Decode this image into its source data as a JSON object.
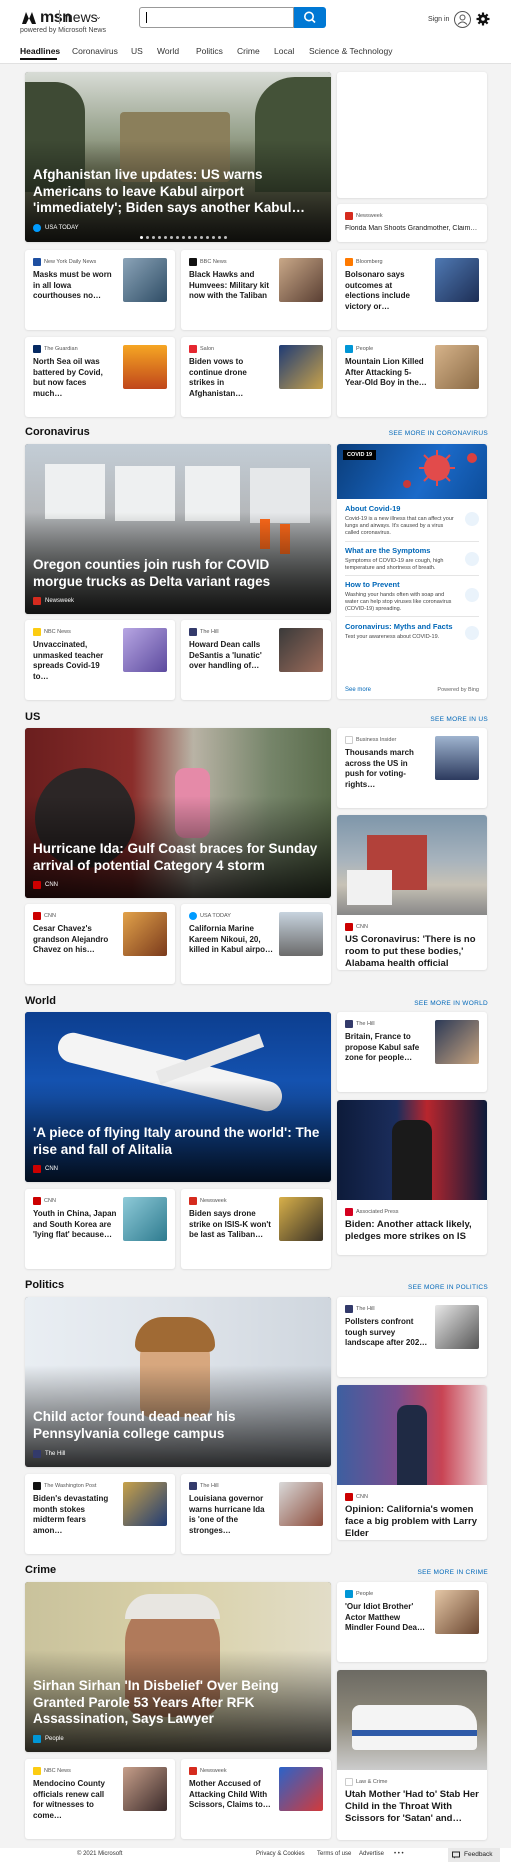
{
  "header": {
    "brand": "msn",
    "product": "news",
    "powered_by": "powered by Microsoft News",
    "search_value": "",
    "sign_in": "Sign in"
  },
  "tabs": [
    "Headlines",
    "Coronavirus",
    "US",
    "World",
    "Politics",
    "Crime",
    "Local",
    "Science & Technology"
  ],
  "headlines": {
    "hero": {
      "title": "Afghanistan live updates: US warns Americans to leave Kabul airport 'immediately'; Biden says another Kabul…",
      "source": "USA TODAY"
    },
    "side": {
      "source": "Newsweek",
      "title": "Florida Man Shoots Grandmother, Claim…"
    },
    "row1": [
      {
        "source": "New York Daily News",
        "title": "Masks must be worn in all Iowa courthouses no…"
      },
      {
        "source": "BBC News",
        "title": "Black Hawks and Humvees: Military kit now with the Taliban"
      },
      {
        "source": "Bloomberg",
        "title": "Bolsonaro says outcomes at elections include victory or…"
      }
    ],
    "row2": [
      {
        "source": "The Guardian",
        "title": "North Sea oil was battered by Covid, but now faces much…"
      },
      {
        "source": "Salon",
        "title": "Biden vows to continue drone strikes in Afghanistan…"
      },
      {
        "source": "People",
        "title": "Mountain Lion Killed After Attacking 5-Year-Old Boy in the…"
      }
    ]
  },
  "coronavirus": {
    "section": "Coronavirus",
    "see_more": "SEE MORE IN CORONAVIRUS",
    "hero": {
      "title": "Oregon counties join rush for COVID morgue trucks as Delta variant rages",
      "source": "Newsweek"
    },
    "widget": {
      "badge": "COVID 19",
      "items": [
        {
          "title": "About Covid-19",
          "desc": "Covid-19 is a new illness that can affect your lungs and airways. It's caused by a virus called coronavirus."
        },
        {
          "title": "What are the Symptoms",
          "desc": "Symptoms of COVID-19 are cough, high temperature and shortness of breath."
        },
        {
          "title": "How to Prevent",
          "desc": "Washing your hands often with soap and water can help stop viruses like coronavirus (COVID-19) spreading."
        },
        {
          "title": "Coronavirus: Myths and Facts",
          "desc": "Test your awareness about COVID-19."
        }
      ],
      "see_more": "See more",
      "powered": "Powered by Bing"
    },
    "row": [
      {
        "source": "NBC News",
        "title": "Unvaccinated, unmasked teacher spreads Covid-19 to…"
      },
      {
        "source": "The Hill",
        "title": "Howard Dean calls DeSantis a 'lunatic' over handling of…"
      }
    ]
  },
  "us": {
    "section": "US",
    "see_more": "SEE MORE IN US",
    "hero": {
      "title": "Hurricane Ida: Gulf Coast braces for Sunday arrival of potential Category 4 storm",
      "source": "CNN"
    },
    "side_small": {
      "source": "Business Insider",
      "title": "Thousands march across the US in push for voting-rights…"
    },
    "side": {
      "source": "CNN",
      "title": "US Coronavirus: 'There is no room to put these bodies,' Alabama health official says…"
    },
    "row": [
      {
        "source": "CNN",
        "title": "Cesar Chavez's grandson Alejandro Chavez on his…"
      },
      {
        "source": "USA TODAY",
        "title": "California Marine Kareem Nikoui, 20, killed in Kabul airpo…"
      }
    ]
  },
  "world": {
    "section": "World",
    "see_more": "SEE MORE IN WORLD",
    "hero": {
      "title": "'A piece of flying Italy around the world': The rise and fall of Alitalia",
      "source": "CNN"
    },
    "side_small": {
      "source": "The Hill",
      "title": "Britain, France to propose Kabul safe zone for people…"
    },
    "side": {
      "source": "Associated Press",
      "title": "Biden: Another attack likely, pledges more strikes on IS"
    },
    "row": [
      {
        "source": "CNN",
        "title": "Youth in China, Japan and South Korea are 'lying flat' because…"
      },
      {
        "source": "Newsweek",
        "title": "Biden says drone strike on ISIS-K won't be last as Taliban…"
      }
    ]
  },
  "politics": {
    "section": "Politics",
    "see_more": "SEE MORE IN POLITICS",
    "hero": {
      "title": "Child actor found dead near his Pennsylvania college campus",
      "source": "The Hill"
    },
    "side_small": {
      "source": "The Hill",
      "title": "Pollsters confront tough survey landscape after 202…"
    },
    "side": {
      "source": "CNN",
      "title": "Opinion: California's women face a big problem with Larry Elder"
    },
    "row": [
      {
        "source": "The Washington Post",
        "title": "Biden's devastating month stokes midterm fears amon…"
      },
      {
        "source": "The Hill",
        "title": "Louisiana governor warns hurricane Ida is 'one of the stronges…"
      }
    ]
  },
  "crime": {
    "section": "Crime",
    "see_more": "SEE MORE IN CRIME",
    "hero": {
      "title": "Sirhan Sirhan 'In Disbelief' Over Being Granted Parole 53 Years After RFK Assassination, Says Lawyer",
      "source": "People"
    },
    "side_small": {
      "source": "People",
      "title": "'Our Idiot Brother' Actor Matthew Mindler Found Dea…"
    },
    "side": {
      "source": "Law & Crime",
      "title": "Utah Mother 'Had to' Stab Her Child in the Throat With Scissors for 'Satan' and…"
    },
    "row": [
      {
        "source": "NBC News",
        "title": "Mendocino County officials renew call for witnesses to come…"
      },
      {
        "source": "Newsweek",
        "title": "Mother Accused of Attacking Child With Scissors, Claims to…"
      }
    ]
  },
  "footer": {
    "copyright": "© 2021 Microsoft",
    "links": [
      "Privacy & Cookies",
      "Terms of use",
      "Advertise"
    ],
    "more": "• • •",
    "feedback": "Feedback"
  }
}
